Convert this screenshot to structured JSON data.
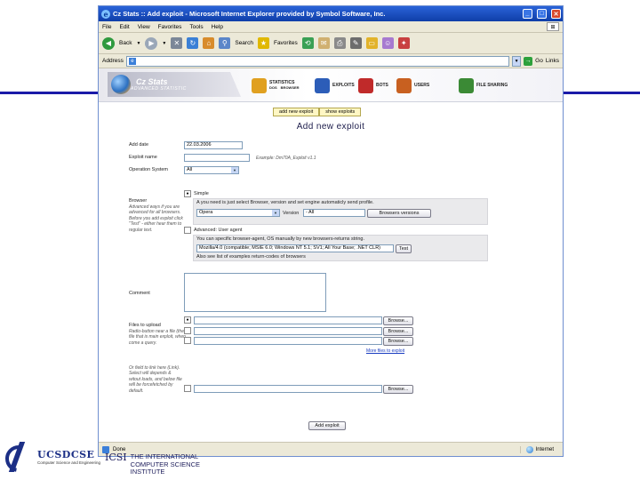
{
  "browser": {
    "title": "Cz Stats :: Add exploit - Microsoft Internet Explorer provided by Symbol Software, Inc.",
    "menu": [
      "File",
      "Edit",
      "View",
      "Favorites",
      "Tools",
      "Help"
    ],
    "toolbar": {
      "back": "Back",
      "search": "Search",
      "favorites": "Favorites"
    },
    "address_label": "Address",
    "go_label": "Go",
    "links_label": "Links",
    "status_text": "Done",
    "zone_text": "Internet"
  },
  "site": {
    "logo_title": "Cz Stats",
    "logo_subtitle": "ADVANCED STATISTIC",
    "tabs": [
      {
        "label": "STATISTICS",
        "sub1": "DOS",
        "sub2": "BROWSER",
        "color": "#e0a020"
      },
      {
        "label": "EXPLOITS",
        "color": "#2c5db8"
      },
      {
        "label": "BOTS",
        "color": "#c02a2a"
      },
      {
        "label": "USERS",
        "color": "#c86020"
      },
      {
        "label": "FILE SHARING",
        "color": "#3b8a35"
      }
    ],
    "subnav": [
      "add new exploit",
      "show exploits"
    ]
  },
  "form": {
    "page_title": "Add new exploit",
    "add_date_label": "Add date",
    "add_date_value": "22.03.2006",
    "exploit_name_label": "Exploit name",
    "exploit_name_value": "",
    "exploit_name_example": "Example: Dm70A_Exploit v1.1",
    "os_label": "Operation System",
    "os_value": "All",
    "browser_label": "Browser",
    "browser_hint": "Advanced ways if you are advanced for all browsers. Before you add exploit click \"Test\" - either hear them to regular text.",
    "simple_label": "Simple",
    "simple_info": "A you need is just select Browser, version and set engine automaticly send profile.",
    "browser_select_value": "Opera",
    "version_label": "Version",
    "version_value": "- All",
    "browsers_versions_button": "Browsers versions",
    "advanced_label": "Advanced: User agent",
    "advanced_info": "You can specific browser-agent, OS manually by new browsers-returns string.",
    "user_agent_value": "Mozilla/4.0 (compatible; MSIE 6.0; Windows NT 5.1; SV1; All Your Base; .NET CLR)",
    "test_button": "Test",
    "advanced_footer": "Also see list of examples return-codes of browsers",
    "comment_label": "Comment",
    "files_label": "Files to upload",
    "files_hint": "Radio-button near a file (the file that is main exploit, when come a query.",
    "browse_button": "Browse...",
    "more_files_link": "More files to exploit",
    "bottom_hint": "Or field to link here (Link). Select will depends & witout loads, and below file will be forcefetched by default.",
    "submit_button": "Add exploit"
  },
  "logos": {
    "ucsd_text": "UCSDCSE",
    "ucsd_tagline": "Computer Science and Engineering",
    "calit_mark": "ICSI",
    "calit_line1": "THE INTERNATIONAL",
    "calit_line2": "COMPUTER SCIENCE",
    "calit_line3": "INSTITUTE"
  }
}
